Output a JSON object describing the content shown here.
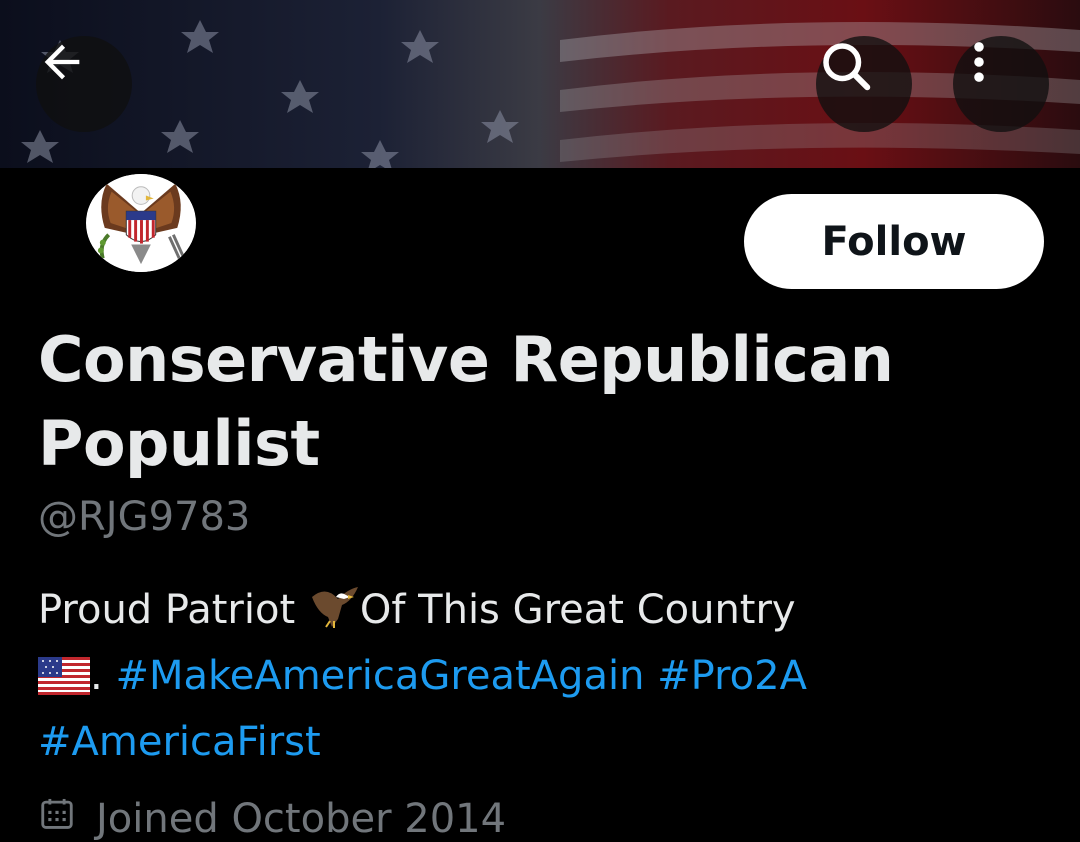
{
  "header": {
    "back_icon": "arrow-left-icon",
    "search_icon": "search-icon",
    "more_icon": "more-vertical-icon"
  },
  "profile": {
    "display_name": "Conservative Republican Populist",
    "handle": "@RJG9783",
    "follow_label": "Follow",
    "bio": {
      "text_before_eagle": "Proud Patriot ",
      "text_after_eagle": "Of This Great Country",
      "text_after_flag": ". ",
      "hashtags": [
        "#MakeAmericaGreatAgain",
        "#Pro2A",
        "#AmericaFirst"
      ]
    },
    "joined": "Joined October 2014"
  },
  "colors": {
    "background": "#000000",
    "primary_text": "#e7e9ea",
    "secondary_text": "#71767b",
    "link": "#1d9bf0",
    "follow_bg": "#ffffff"
  }
}
